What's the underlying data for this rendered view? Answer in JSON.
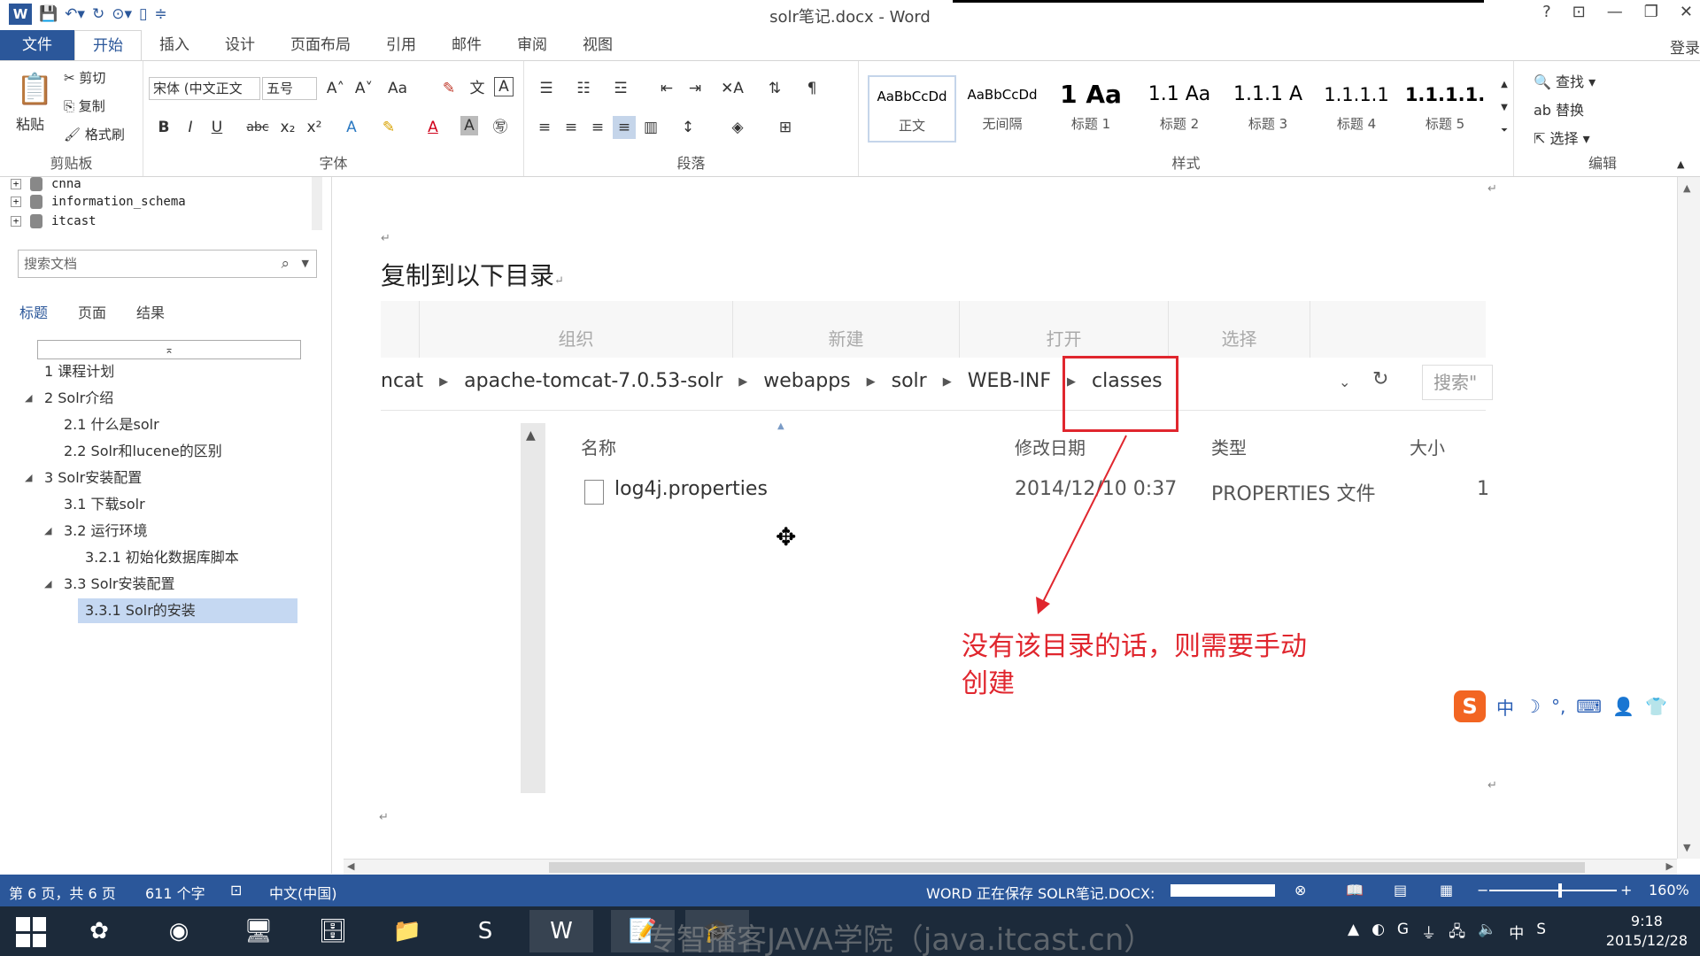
{
  "window": {
    "title": "solr笔记.docx - Word",
    "controls": [
      "?",
      "⊡",
      "—",
      "❐",
      "✕"
    ]
  },
  "ribbon_tabs": {
    "file": "文件",
    "items": [
      "开始",
      "插入",
      "设计",
      "页面布局",
      "引用",
      "邮件",
      "审阅",
      "视图"
    ],
    "active": "开始",
    "login": "登录"
  },
  "clipboard": {
    "paste": "粘贴",
    "cut": "剪切",
    "copy": "复制",
    "format_painter": "格式刷",
    "label": "剪贴板"
  },
  "font": {
    "name": "宋体 (中文正文",
    "size": "五号",
    "label": "字体",
    "buttons": [
      "B",
      "I",
      "U",
      "abc",
      "x₂",
      "x²"
    ]
  },
  "paragraph": {
    "label": "段落"
  },
  "styles": {
    "label": "样式",
    "items": [
      {
        "preview": "AaBbCcDd",
        "name": "正文"
      },
      {
        "preview": "AaBbCcDd",
        "name": "无间隔"
      },
      {
        "preview": "1  Aa",
        "name": "标题 1"
      },
      {
        "preview": "1.1  Aa",
        "name": "标题 2"
      },
      {
        "preview": "1.1.1  A",
        "name": "标题 3"
      },
      {
        "preview": "1.1.1.1",
        "name": "标题 4"
      },
      {
        "preview": "1.1.1.1.",
        "name": "标题 5"
      }
    ]
  },
  "editing": {
    "label": "编辑",
    "find": "查找",
    "replace": "替换",
    "select": "选择"
  },
  "nav": {
    "tree": [
      "cnna",
      "information_schema",
      "itcast"
    ],
    "search_placeholder": "搜索文档",
    "tabs": [
      "标题",
      "页面",
      "结果"
    ],
    "active_tab": "标题",
    "collapse": "⌅",
    "headings": [
      "1 课程计划",
      "2 Solr介绍",
      "2.1 什么是solr",
      "2.2 Solr和lucene的区别",
      "3 Solr安装配置",
      "3.1 下载solr",
      "3.2 运行环境",
      "3.2.1 初始化数据库脚本",
      "3.3 Solr安装配置",
      "3.3.1 Solr的安装"
    ],
    "selected": "3.3.1 Solr的安装"
  },
  "document": {
    "heading": "复制到以下目录",
    "explorer": {
      "toolbar": [
        "组织",
        "新建",
        "打开",
        "选择"
      ],
      "breadcrumb": [
        "ncat",
        "apache-tomcat-7.0.53-solr",
        "webapps",
        "solr",
        "WEB-INF",
        "classes"
      ],
      "search": "搜索\"",
      "columns": [
        "名称",
        "修改日期",
        "类型",
        "大小"
      ],
      "files": [
        {
          "name": "log4j.properties",
          "modified": "2014/12/10 0:37",
          "type": "PROPERTIES 文件",
          "size": "1"
        }
      ]
    },
    "annotation": "没有该目录的话，则需要手动创建",
    "highlight_color": "#e0262e"
  },
  "ime": {
    "items": [
      "中",
      "☽",
      "°,",
      "⌨",
      "👤",
      "👕",
      "🔧"
    ]
  },
  "side_widget": "35",
  "status": {
    "page": "第 6 页，共 6 页",
    "words": "611 个字",
    "lang": "中文(中国)",
    "saving": "WORD 正在保存 SOLR笔记.DOCX:",
    "zoom": "160%"
  },
  "taskbar": {
    "watermark": "专智播客JAVA学院（java.itcast.cn）",
    "time": "9:18",
    "date": "2015/12/28",
    "tray_lang": "中"
  },
  "colors": {
    "word_blue": "#2b579a",
    "selection": "#c5d8f2",
    "red": "#e0262e"
  }
}
